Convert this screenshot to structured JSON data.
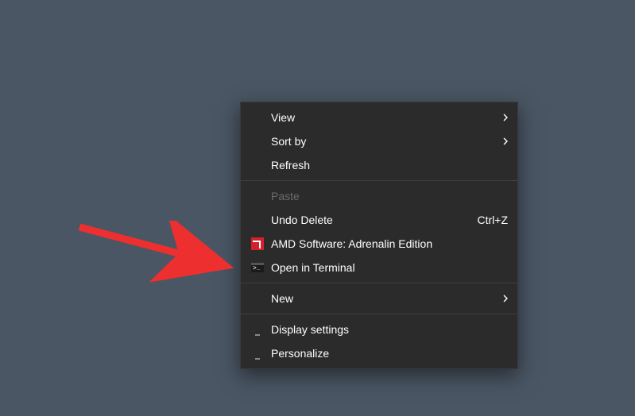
{
  "menu": {
    "view": {
      "label": "View",
      "has_submenu": true
    },
    "sort_by": {
      "label": "Sort by",
      "has_submenu": true
    },
    "refresh": {
      "label": "Refresh"
    },
    "paste": {
      "label": "Paste",
      "disabled": true
    },
    "undo_delete": {
      "label": "Undo Delete",
      "shortcut": "Ctrl+Z"
    },
    "amd": {
      "label": "AMD Software: Adrenalin Edition"
    },
    "open_terminal": {
      "label": "Open in Terminal"
    },
    "new": {
      "label": "New",
      "has_submenu": true
    },
    "display_settings": {
      "label": "Display settings"
    },
    "personalize": {
      "label": "Personalize"
    }
  },
  "annotation": {
    "arrow_color": "#ed2f2f"
  }
}
